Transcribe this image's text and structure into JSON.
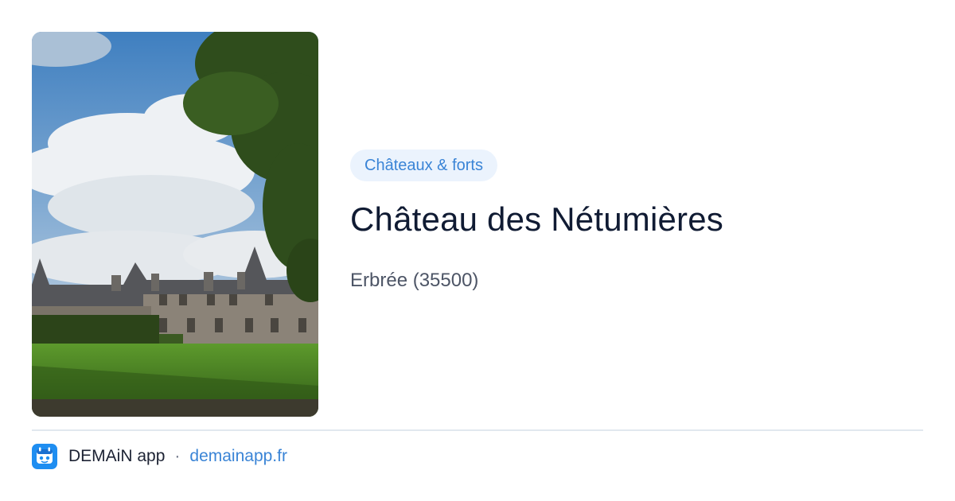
{
  "category": {
    "label": "Châteaux & forts"
  },
  "place": {
    "title": "Château des Nétumières",
    "location": "Erbrée (35500)"
  },
  "footer": {
    "app_name": "DEMAiN app",
    "separator": "·",
    "domain": "demainapp.fr"
  },
  "icons": {
    "app": "demain-app-logo-icon"
  },
  "colors": {
    "accent": "#3a84d6",
    "badge_background": "#ebf3fd",
    "title": "#101b33",
    "muted_text": "#4d5566",
    "divider": "#e1e8ef",
    "app_icon_background": "#1f8ef1"
  }
}
